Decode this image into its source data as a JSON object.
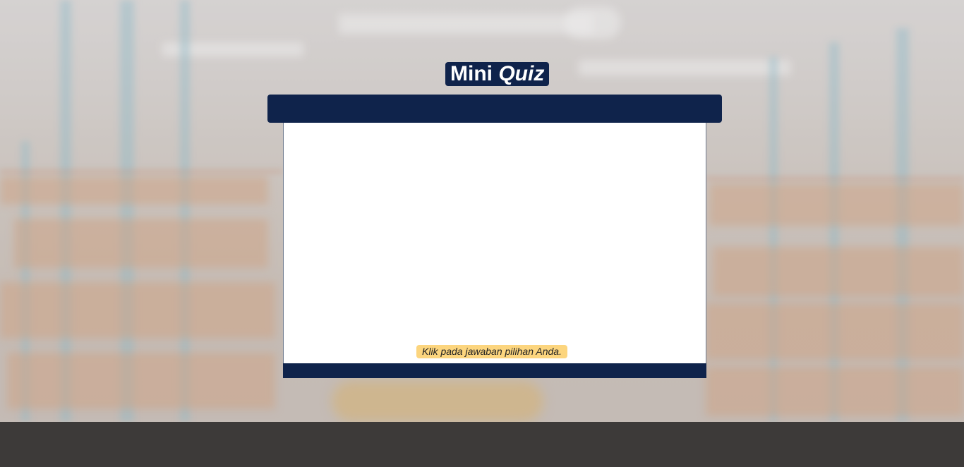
{
  "title": {
    "part1": "Mini",
    "part2": "Quiz"
  },
  "quiz": {
    "instruction": "Klik pada jawaban pilihan Anda."
  },
  "colors": {
    "navy": "#0f234b",
    "instruction_bg": "#fcd57e",
    "footer_bar": "#3d3a39"
  }
}
